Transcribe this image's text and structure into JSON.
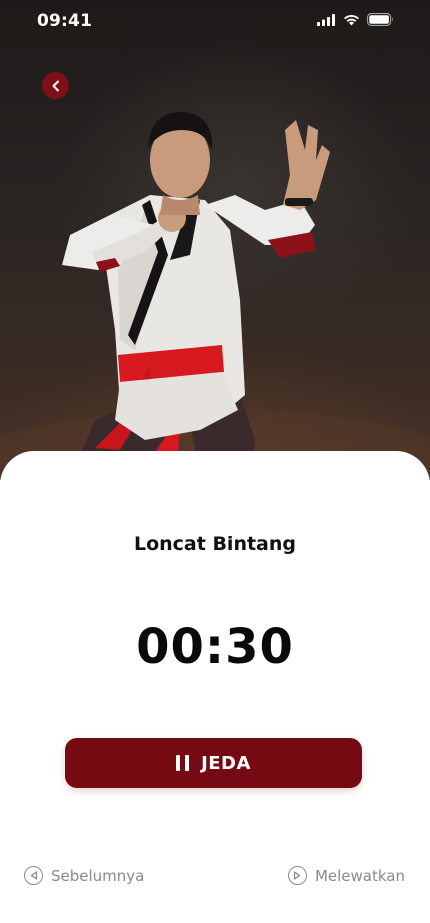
{
  "status_bar": {
    "time": "09:41",
    "icons": [
      "signal-icon",
      "wifi-icon",
      "battery-icon"
    ]
  },
  "header": {
    "back_icon": "chevron-left-icon"
  },
  "exercise": {
    "name": "Loncat Bintang",
    "timer": "00:30"
  },
  "controls": {
    "pause_label": "JEDA",
    "previous_label": "Sebelumnya",
    "skip_label": "Melewatkan"
  },
  "colors": {
    "accent": "#760a12",
    "back_button": "#7e1019",
    "muted_text": "#8a8a8a"
  }
}
